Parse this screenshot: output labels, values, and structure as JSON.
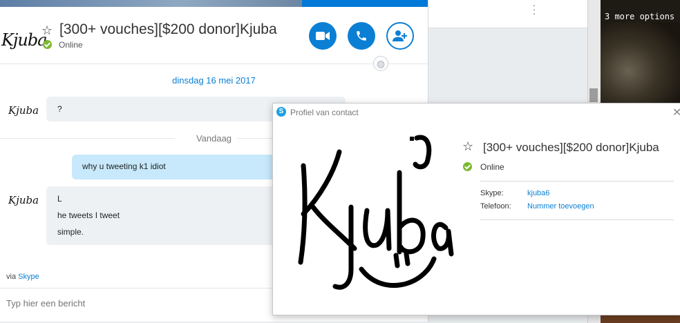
{
  "chat": {
    "contact_name": "[300+ vouches][$200 donor]Kjuba",
    "status": "Online",
    "avatar_text": "Kjuba",
    "date_separator_1": "dinsdag 16 mei 2017",
    "date_separator_2": "Vandaag",
    "messages": [
      {
        "lines": [
          "?"
        ],
        "from": "contact"
      },
      {
        "lines": [
          "why u tweeting k1 idiot"
        ],
        "from": "me"
      },
      {
        "lines": [
          "L",
          "he tweets I tweet",
          "simple."
        ],
        "from": "contact"
      }
    ],
    "via_prefix": "via",
    "via_link": "Skype",
    "composer_placeholder": "Typ hier een bericht",
    "icons": {
      "video": "video-camera-icon",
      "call": "phone-icon",
      "add": "add-person-icon",
      "favorite": "star-outline-icon",
      "status": "online-check-icon",
      "globe": "globe-icon"
    }
  },
  "background_window": {
    "menu_icon": "vertical-ellipsis-icon"
  },
  "game": {
    "overlay_text": "3 more options"
  },
  "profile": {
    "window_title": "Profiel van contact",
    "name": "[300+ vouches][$200 donor]Kjuba",
    "status": "Online",
    "avatar_text": "Kjuba",
    "fields": [
      {
        "label": "Skype:",
        "value": "kjuba6"
      },
      {
        "label": "Telefoon:",
        "value": "Nummer toevoegen"
      }
    ]
  },
  "colors": {
    "skype_blue": "#0b7fd4",
    "online_green": "#7cb82f",
    "outgoing_bubble": "#c7e9fb",
    "incoming_bubble": "#eef1f4"
  }
}
